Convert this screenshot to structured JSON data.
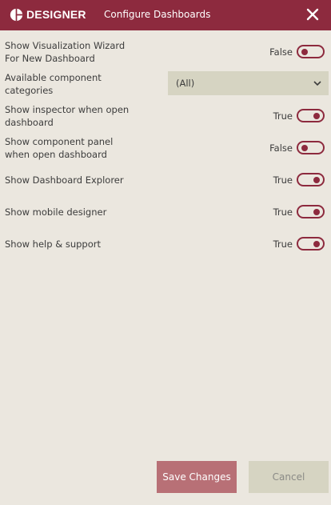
{
  "header": {
    "brand": "DESIGNER",
    "title": "Configure Dashboards",
    "logo_icon": "pie-chart-icon",
    "close_icon": "close-icon"
  },
  "settings": {
    "viz_wizard": {
      "label": "Show Visualization Wizard For New Dashboard",
      "value": "False"
    },
    "categories": {
      "label": "Available component categories",
      "selected": "(All)"
    },
    "inspector": {
      "label": "Show inspector when open dashboard",
      "value": "True"
    },
    "component_panel": {
      "label": "Show component panel when open dashboard",
      "value": "False"
    },
    "explorer": {
      "label": "Show Dashboard Explorer",
      "value": "True"
    },
    "mobile_designer": {
      "label": "Show mobile designer",
      "value": "True"
    },
    "help": {
      "label": "Show help & support",
      "value": "True"
    }
  },
  "footer": {
    "save_label": "Save Changes",
    "cancel_label": "Cancel"
  },
  "colors": {
    "accent": "#8d2a3e",
    "background": "#ebe7df",
    "save_button": "#b87076",
    "neutral_button": "#d6d4c2"
  }
}
